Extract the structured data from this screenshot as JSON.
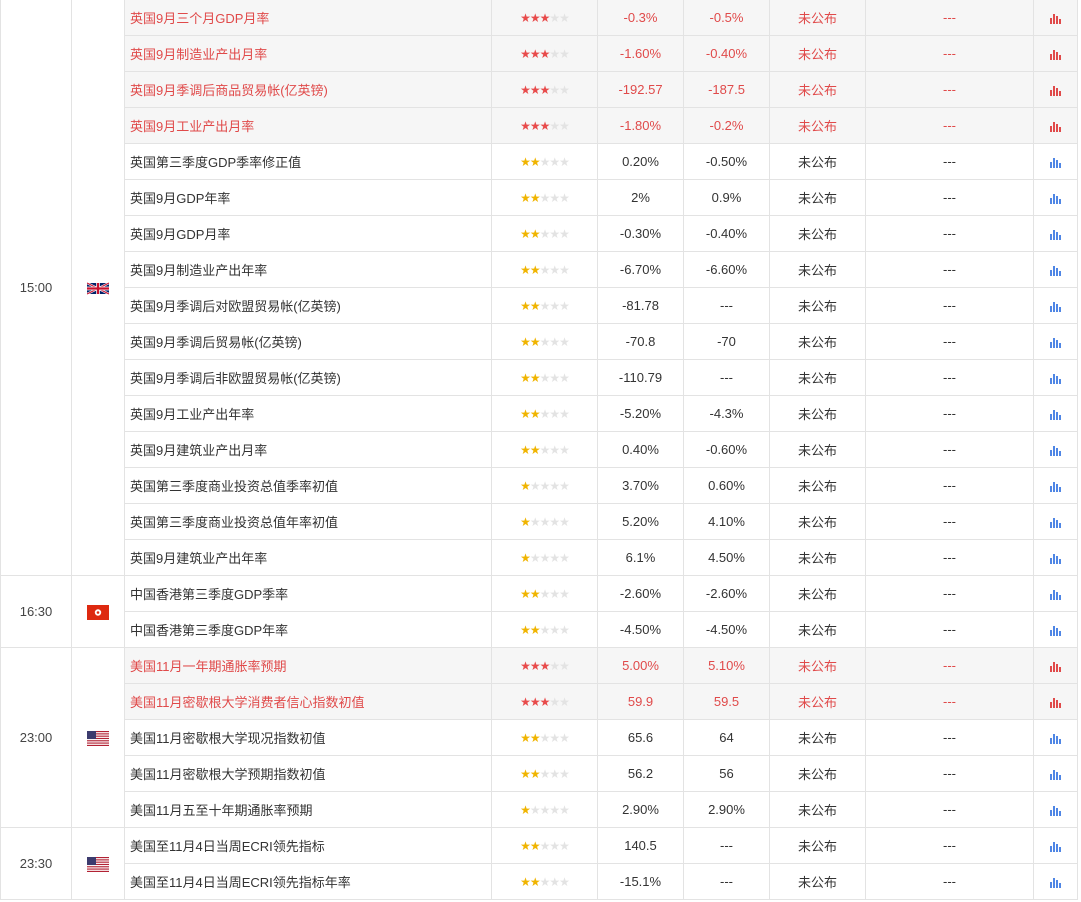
{
  "groups": [
    {
      "time": "15:00",
      "flag": "uk-flag",
      "rows": [
        {
          "name": "英国9月三个月GDP月率",
          "stars": 3,
          "prev": "-0.3%",
          "forecast": "-0.5%",
          "actual": "未公布",
          "impact": "---",
          "hi": true
        },
        {
          "name": "英国9月制造业产出月率",
          "stars": 3,
          "prev": "-1.60%",
          "forecast": "-0.40%",
          "actual": "未公布",
          "impact": "---",
          "hi": true
        },
        {
          "name": "英国9月季调后商品贸易帐(亿英镑)",
          "stars": 3,
          "prev": "-192.57",
          "forecast": "-187.5",
          "actual": "未公布",
          "impact": "---",
          "hi": true
        },
        {
          "name": "英国9月工业产出月率",
          "stars": 3,
          "prev": "-1.80%",
          "forecast": "-0.2%",
          "actual": "未公布",
          "impact": "---",
          "hi": true
        },
        {
          "name": "英国第三季度GDP季率修正值",
          "stars": 2,
          "prev": "0.20%",
          "forecast": "-0.50%",
          "actual": "未公布",
          "impact": "---",
          "hi": false
        },
        {
          "name": "英国9月GDP年率",
          "stars": 2,
          "prev": "2%",
          "forecast": "0.9%",
          "actual": "未公布",
          "impact": "---",
          "hi": false
        },
        {
          "name": "英国9月GDP月率",
          "stars": 2,
          "prev": "-0.30%",
          "forecast": "-0.40%",
          "actual": "未公布",
          "impact": "---",
          "hi": false
        },
        {
          "name": "英国9月制造业产出年率",
          "stars": 2,
          "prev": "-6.70%",
          "forecast": "-6.60%",
          "actual": "未公布",
          "impact": "---",
          "hi": false
        },
        {
          "name": "英国9月季调后对欧盟贸易帐(亿英镑)",
          "stars": 2,
          "prev": "-81.78",
          "forecast": "---",
          "actual": "未公布",
          "impact": "---",
          "hi": false
        },
        {
          "name": "英国9月季调后贸易帐(亿英镑)",
          "stars": 2,
          "prev": "-70.8",
          "forecast": "-70",
          "actual": "未公布",
          "impact": "---",
          "hi": false
        },
        {
          "name": "英国9月季调后非欧盟贸易帐(亿英镑)",
          "stars": 2,
          "prev": "-110.79",
          "forecast": "---",
          "actual": "未公布",
          "impact": "---",
          "hi": false
        },
        {
          "name": "英国9月工业产出年率",
          "stars": 2,
          "prev": "-5.20%",
          "forecast": "-4.3%",
          "actual": "未公布",
          "impact": "---",
          "hi": false
        },
        {
          "name": "英国9月建筑业产出月率",
          "stars": 2,
          "prev": "0.40%",
          "forecast": "-0.60%",
          "actual": "未公布",
          "impact": "---",
          "hi": false
        },
        {
          "name": "英国第三季度商业投资总值季率初值",
          "stars": 1,
          "prev": "3.70%",
          "forecast": "0.60%",
          "actual": "未公布",
          "impact": "---",
          "hi": false
        },
        {
          "name": "英国第三季度商业投资总值年率初值",
          "stars": 1,
          "prev": "5.20%",
          "forecast": "4.10%",
          "actual": "未公布",
          "impact": "---",
          "hi": false
        },
        {
          "name": "英国9月建筑业产出年率",
          "stars": 1,
          "prev": "6.1%",
          "forecast": "4.50%",
          "actual": "未公布",
          "impact": "---",
          "hi": false
        }
      ]
    },
    {
      "time": "16:30",
      "flag": "hk-flag",
      "rows": [
        {
          "name": "中国香港第三季度GDP季率",
          "stars": 2,
          "prev": "-2.60%",
          "forecast": "-2.60%",
          "actual": "未公布",
          "impact": "---",
          "hi": false
        },
        {
          "name": "中国香港第三季度GDP年率",
          "stars": 2,
          "prev": "-4.50%",
          "forecast": "-4.50%",
          "actual": "未公布",
          "impact": "---",
          "hi": false
        }
      ]
    },
    {
      "time": "23:00",
      "flag": "us-flag",
      "rows": [
        {
          "name": "美国11月一年期通胀率预期",
          "stars": 3,
          "prev": "5.00%",
          "forecast": "5.10%",
          "actual": "未公布",
          "impact": "---",
          "hi": true
        },
        {
          "name": "美国11月密歇根大学消费者信心指数初值",
          "stars": 3,
          "prev": "59.9",
          "forecast": "59.5",
          "actual": "未公布",
          "impact": "---",
          "hi": true
        },
        {
          "name": "美国11月密歇根大学现况指数初值",
          "stars": 2,
          "prev": "65.6",
          "forecast": "64",
          "actual": "未公布",
          "impact": "---",
          "hi": false
        },
        {
          "name": "美国11月密歇根大学预期指数初值",
          "stars": 2,
          "prev": "56.2",
          "forecast": "56",
          "actual": "未公布",
          "impact": "---",
          "hi": false
        },
        {
          "name": "美国11月五至十年期通胀率预期",
          "stars": 1,
          "prev": "2.90%",
          "forecast": "2.90%",
          "actual": "未公布",
          "impact": "---",
          "hi": false
        }
      ]
    },
    {
      "time": "23:30",
      "flag": "us-flag",
      "rows": [
        {
          "name": "美国至11月4日当周ECRI领先指标",
          "stars": 2,
          "prev": "140.5",
          "forecast": "---",
          "actual": "未公布",
          "impact": "---",
          "hi": false
        },
        {
          "name": "美国至11月4日当周ECRI领先指标年率",
          "stars": 2,
          "prev": "-15.1%",
          "forecast": "---",
          "actual": "未公布",
          "impact": "---",
          "hi": false
        }
      ]
    }
  ],
  "icons": {
    "star": "star-icon",
    "chart": "bar-chart-icon"
  },
  "colors": {
    "highlight_text": "#e04a4a",
    "highlight_bg": "#f6f6f6",
    "star_high": "#e84b4b",
    "star_mid": "#f0b400",
    "star_off": "#e3e3e3",
    "chart_icon": "#4f86e5"
  }
}
